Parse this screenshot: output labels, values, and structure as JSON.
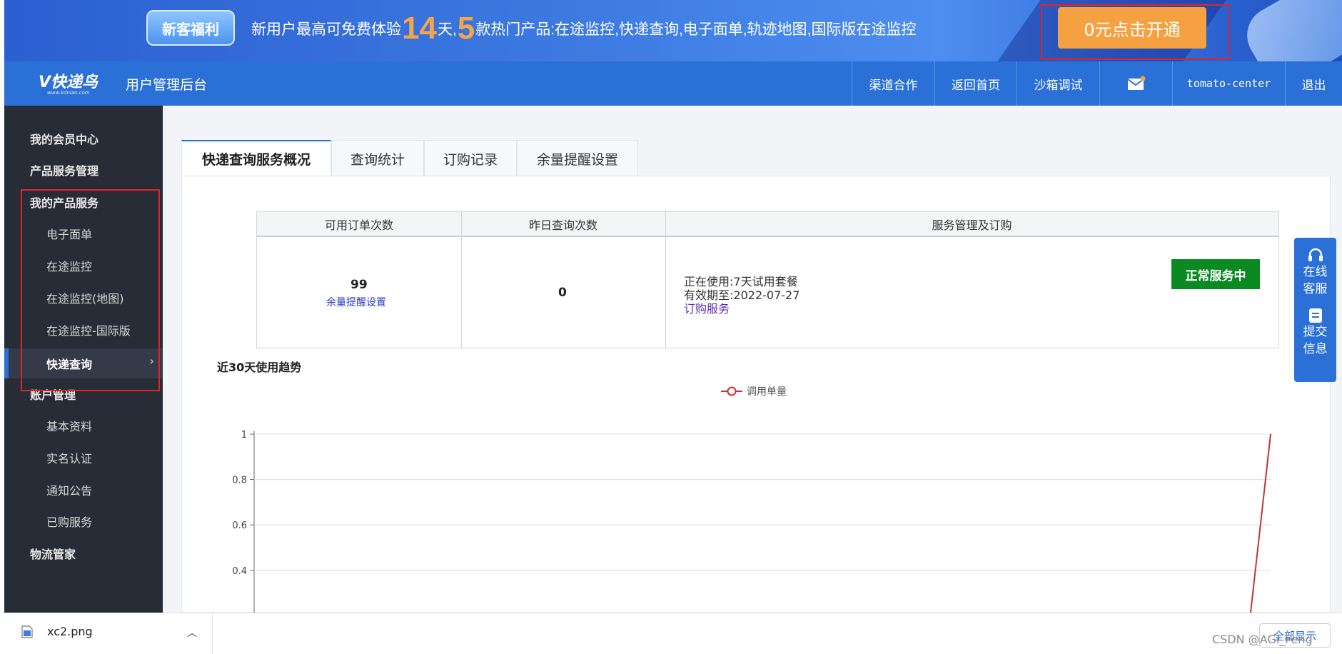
{
  "banner": {
    "badge": "新客福利",
    "promo_prefix": "新用户最高可免费体验",
    "days": "14",
    "mid1": "天,",
    "products_count": "5",
    "promo_suffix": "款热门产品:在途监控,快递查询,电子面单,轨迹地图,国际版在途监控",
    "cta": "0元点击开通"
  },
  "header": {
    "logo_text": "V快递鸟",
    "logo_sub": "www.kdniao.com",
    "title": "用户管理后台",
    "nav": [
      "渠道合作",
      "返回首页",
      "沙箱调试",
      "",
      "tomato-center",
      "退出"
    ],
    "accent": "#2a70d6"
  },
  "sidebar": {
    "items": [
      {
        "label": "我的会员中心",
        "type": "section"
      },
      {
        "label": "产品服务管理",
        "type": "section"
      },
      {
        "label": "我的产品服务",
        "type": "section"
      },
      {
        "label": "电子面单",
        "type": "sub"
      },
      {
        "label": "在途监控",
        "type": "sub"
      },
      {
        "label": "在途监控(地图)",
        "type": "sub"
      },
      {
        "label": "在途监控-国际版",
        "type": "sub"
      },
      {
        "label": "快递查询",
        "type": "active"
      },
      {
        "label": "账户管理",
        "type": "section"
      },
      {
        "label": "基本资料",
        "type": "sub"
      },
      {
        "label": "实名认证",
        "type": "sub"
      },
      {
        "label": "通知公告",
        "type": "sub"
      },
      {
        "label": "已购服务",
        "type": "sub"
      },
      {
        "label": "物流管家",
        "type": "section"
      }
    ]
  },
  "tabs": [
    "快递查询服务概况",
    "查询统计",
    "订购记录",
    "余量提醒设置"
  ],
  "stats": {
    "headers": [
      "可用订单次数",
      "昨日查询次数",
      "服务管理及订购"
    ],
    "available_orders": "99",
    "reminder_link": "余量提醒设置",
    "yesterday_queries": "0",
    "in_use_label": "正在使用:",
    "in_use_value": "7天试用套餐",
    "expiry_label": "有效期至:",
    "expiry_value": "2022-07-27",
    "order_link": "订购服务",
    "status": "正常服务中"
  },
  "trend": {
    "title": "近30天使用趋势"
  },
  "chart_data": {
    "type": "line",
    "title": "近30天使用趋势",
    "series": [
      {
        "name": "调用单量",
        "color": "#c23531"
      }
    ],
    "y_ticks": [
      "1",
      "0.8",
      "0.6",
      "0.4"
    ],
    "ylim": [
      0.4,
      1
    ],
    "grid": true,
    "legend_position": "top-center",
    "visible_segment": {
      "from_y": 0,
      "to_y": 1,
      "note": "last point rises to 1 at right edge"
    }
  },
  "floatbar": {
    "items": [
      {
        "label": "在线客服",
        "icon": "headset-icon"
      },
      {
        "label": "提交信息",
        "icon": "form-icon"
      }
    ]
  },
  "download_bar": {
    "filename": "xc2.png",
    "show_all": "全部显示"
  },
  "watermark": "CSDN @AGi_Feng"
}
